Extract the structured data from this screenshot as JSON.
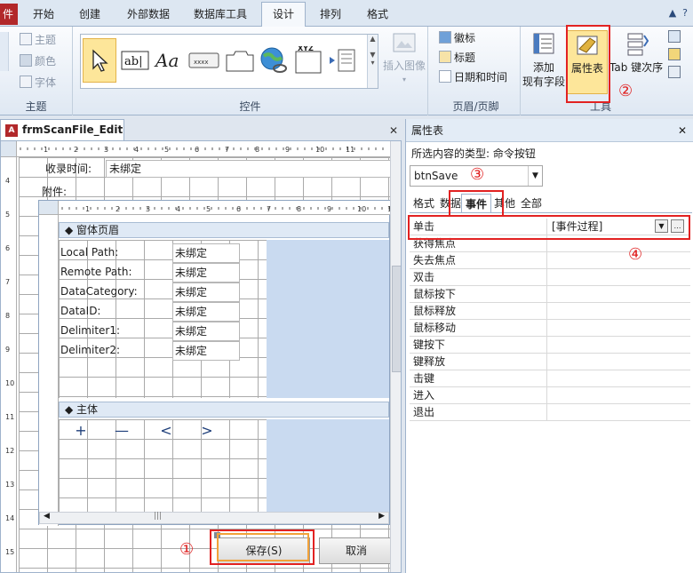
{
  "ribbon_tabs": {
    "file": "件",
    "items": [
      "开始",
      "创建",
      "外部数据",
      "数据库工具",
      "设计",
      "排列",
      "格式"
    ],
    "active_index": 4
  },
  "ribbon": {
    "themes_group": {
      "label": "主题",
      "themes": "主题",
      "colors": "颜色",
      "fonts": "字体"
    },
    "controls_group": {
      "label": "控件",
      "insert_image": "插入图像"
    },
    "header_group": {
      "label": "页眉/页脚",
      "logo": "徽标",
      "title": "标题",
      "datetime": "日期和时间"
    },
    "tools_group": {
      "label": "工具",
      "add_existing": "添加\n现有字段",
      "add_l1": "添加",
      "add_l2": "现有字段",
      "property_sheet": "属性表",
      "tab_order": "Tab 键次序"
    }
  },
  "annotations": {
    "one": "①",
    "two": "②",
    "three": "③",
    "four": "④"
  },
  "document": {
    "tab_title": "frmScanFile_Edit",
    "receive_time_label": "收录时间:",
    "receive_time_value": "未绑定",
    "attachments_label": "附件:",
    "subform": {
      "header_section": "窗体页眉",
      "detail_section": "主体",
      "fields": [
        {
          "label": "Local Path:",
          "value": "未绑定"
        },
        {
          "label": "Remote Path:",
          "value": "未绑定"
        },
        {
          "label": "DataCategory:",
          "value": "未绑定"
        },
        {
          "label": "DataID:",
          "value": "未绑定"
        },
        {
          "label": "Delimiter1:",
          "value": "未绑定"
        },
        {
          "label": "Delimiter2:",
          "value": "未绑定"
        }
      ],
      "nav_buttons": [
        "+",
        "—",
        "<",
        ">"
      ]
    },
    "save_button": "保存(S)",
    "cancel_button": "取消",
    "ruler_numbers": [
      "1",
      "2",
      "3",
      "4",
      "5",
      "6",
      "7",
      "8",
      "9",
      "10",
      "11"
    ],
    "v_ruler_numbers": [
      "4",
      "5",
      "6",
      "7",
      "8",
      "9",
      "10",
      "11",
      "12",
      "13",
      "14",
      "15"
    ]
  },
  "property_sheet": {
    "title": "属性表",
    "selection_type": "所选内容的类型: 命令按钮",
    "selected_object": "btnSave",
    "tabs": [
      "格式",
      "数据",
      "事件",
      "其他",
      "全部"
    ],
    "active_tab": 2,
    "rows": [
      {
        "key": "单击",
        "value": "[事件过程]"
      },
      {
        "key": "获得焦点",
        "value": ""
      },
      {
        "key": "失去焦点",
        "value": ""
      },
      {
        "key": "双击",
        "value": ""
      },
      {
        "key": "鼠标按下",
        "value": ""
      },
      {
        "key": "鼠标释放",
        "value": ""
      },
      {
        "key": "鼠标移动",
        "value": ""
      },
      {
        "key": "键按下",
        "value": ""
      },
      {
        "key": "键释放",
        "value": ""
      },
      {
        "key": "击键",
        "value": ""
      },
      {
        "key": "进入",
        "value": ""
      },
      {
        "key": "退出",
        "value": ""
      }
    ]
  },
  "colors": {
    "highlight_red": "#e22222",
    "access_red": "#b2282a",
    "selection_yellow": "#fde69a"
  }
}
